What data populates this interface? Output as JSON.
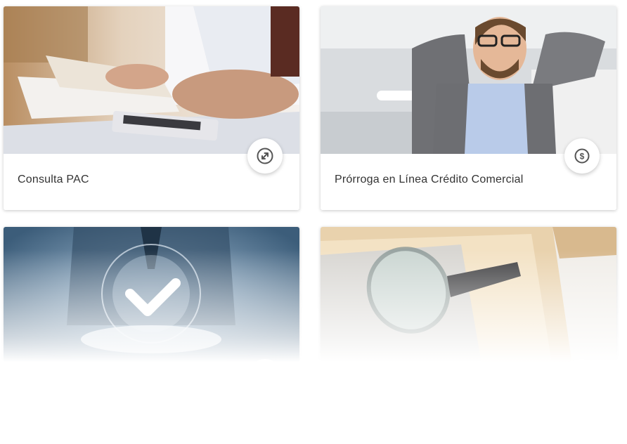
{
  "cards": [
    {
      "title": "Consulta PAC",
      "icon": "exchange-icon",
      "image": "calculator-papers-photo"
    },
    {
      "title": "Prórroga en Línea Crédito Comercial",
      "icon": "dollar-icon",
      "image": "relaxed-man-photo"
    },
    {
      "title": "",
      "icon": "document-icon",
      "image": "businessman-check-hologram-photo"
    },
    {
      "title": "",
      "icon": "document-icon",
      "image": "magnifier-folders-photo"
    }
  ],
  "colors": {
    "icon": "#555555",
    "text": "#333333"
  }
}
